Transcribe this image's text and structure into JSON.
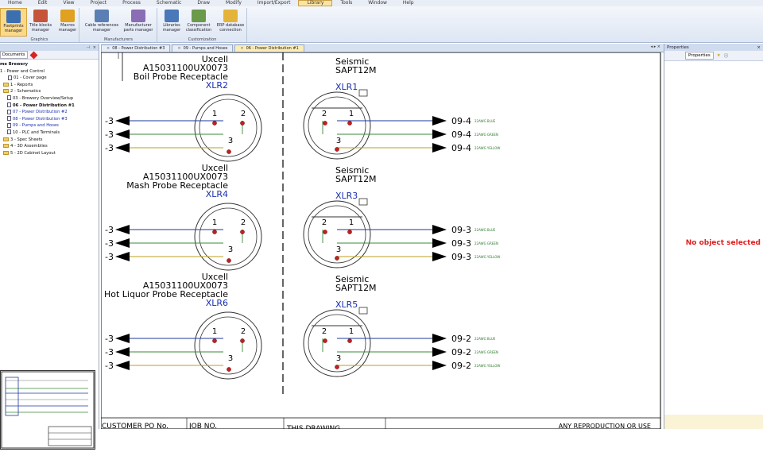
{
  "menubar": {
    "items": [
      "Home",
      "Edit",
      "View",
      "Project",
      "Process",
      "Schematic",
      "Draw",
      "Modify",
      "Import/Export",
      "Library",
      "Tools",
      "Window",
      "Help"
    ],
    "active": "Library"
  },
  "ribbon": {
    "groups": [
      {
        "name": "Graphics",
        "buttons": [
          "Footprints manager",
          "Title blocks manager",
          "Macros manager"
        ]
      },
      {
        "name": "Manufacturers",
        "buttons": [
          "Cable references manager",
          "Manufacturer parts manager"
        ]
      },
      {
        "name": "Customization",
        "buttons": [
          "Libraries manager",
          "Component classification",
          "ERP database connection"
        ]
      }
    ]
  },
  "left_panel": {
    "tab": "Documents",
    "tree": [
      {
        "label": "me Brewery",
        "kind": "root"
      },
      {
        "label": "1 - Power and Control",
        "kind": "text"
      },
      {
        "label": "01 - Cover page",
        "kind": "page"
      },
      {
        "label": "1 - Reports",
        "kind": "folder"
      },
      {
        "label": "2 - Schematics",
        "kind": "folder"
      },
      {
        "label": "03 - Brewery Overview/Setup",
        "kind": "page"
      },
      {
        "label": "06 - Power Distribution #1",
        "kind": "page",
        "bold": true
      },
      {
        "label": "07 - Power Distribution #2",
        "kind": "page",
        "blue": true
      },
      {
        "label": "08 - Power Distribution #3",
        "kind": "page",
        "blue": true
      },
      {
        "label": "09 - Pumps and Hoses",
        "kind": "page",
        "blue": true
      },
      {
        "label": "10 - PLC and Terminals",
        "kind": "page"
      },
      {
        "label": "3 - Spec Sheets",
        "kind": "folder"
      },
      {
        "label": "4 - 3D Assemblies",
        "kind": "folder"
      },
      {
        "label": "5 - 2D Cabinet Layout",
        "kind": "folder"
      }
    ]
  },
  "doc_tabs": [
    "08 - Power Distribution #3",
    "09 - Pumps and Hoses",
    "06 - Power Distribution #1"
  ],
  "doc_tab_active": 2,
  "drawing": {
    "rows": [
      {
        "left_maker": "Uxcell",
        "left_part": "A15031100UX0073",
        "left_desc": "Boil Probe Receptacle",
        "left_tag": "XLR2",
        "right_maker": "Seismic",
        "right_part": "SAPT12M",
        "right_tag": "XLR1",
        "left_wire": "-3",
        "right_wire": "09-4"
      },
      {
        "left_maker": "Uxcell",
        "left_part": "A15031100UX0073",
        "left_desc": "Mash Probe Receptacle",
        "left_tag": "XLR4",
        "right_maker": "Seismic",
        "right_part": "SAPT12M",
        "right_tag": "XLR3",
        "left_wire": "-3",
        "right_wire": "09-3"
      },
      {
        "left_maker": "Uxcell",
        "left_part": "A15031100UX0073",
        "left_desc": "Hot Liquor Probe Receptacle",
        "left_tag": "XLR6",
        "right_maker": "Seismic",
        "right_part": "SAPT12M",
        "right_tag": "XLR5",
        "left_wire": "-3",
        "right_wire": "09-2"
      }
    ],
    "pins": {
      "p1": "1",
      "p2": "2",
      "p3": "3"
    },
    "wire_colors": [
      "22AWG BLUE",
      "22AWG GREEN",
      "22AWG YELLOW"
    ],
    "title_block": [
      "CUSTOMER PO No.",
      "JOB NO.",
      "THIS DRAWING",
      "ANY REPRODUCTION OR USE"
    ]
  },
  "right_panel": {
    "title": "Properties",
    "tab": "Properties",
    "message": "No object selected"
  },
  "colors": {
    "wire_blue": "#1e3a9a",
    "wire_green": "#3a8a3a",
    "wire_yellow": "#b8a01a",
    "pin_dot": "#c02020",
    "tag_blue": "#1a2fb0",
    "no_object": "#e02020"
  }
}
